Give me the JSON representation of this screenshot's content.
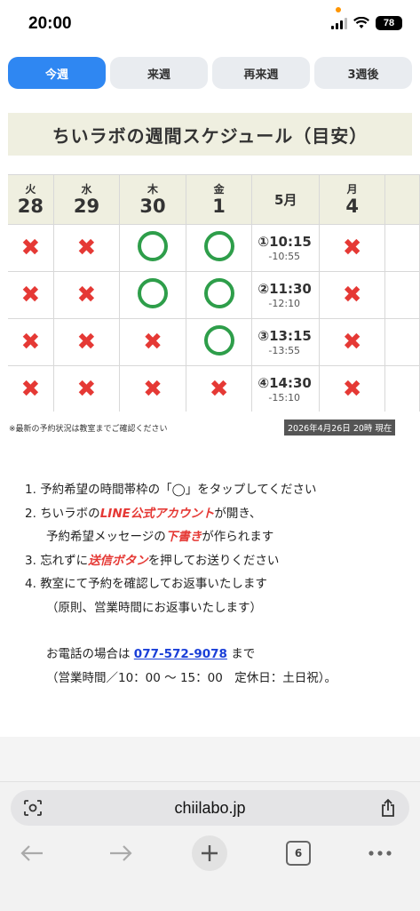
{
  "status": {
    "time": "20:00",
    "battery": "78"
  },
  "tabs": [
    {
      "label": "今週",
      "active": true
    },
    {
      "label": "来週",
      "active": false
    },
    {
      "label": "再来週",
      "active": false
    },
    {
      "label": "3週後",
      "active": false
    }
  ],
  "title": "ちいラボの週間スケジュール（目安）",
  "schedule": {
    "days": [
      {
        "dow": "火",
        "num": "28"
      },
      {
        "dow": "水",
        "num": "29"
      },
      {
        "dow": "木",
        "num": "30"
      },
      {
        "dow": "金",
        "num": "1"
      },
      {
        "month": "5月"
      },
      {
        "dow": "月",
        "num": "4"
      }
    ],
    "slots": [
      {
        "start": "①10:15",
        "end": "-10:55"
      },
      {
        "start": "②11:30",
        "end": "-12:10"
      },
      {
        "start": "③13:15",
        "end": "-13:55"
      },
      {
        "start": "④14:30",
        "end": "-15:10"
      }
    ],
    "availability": [
      [
        "unavailable",
        "unavailable",
        "available",
        "available",
        "unavailable"
      ],
      [
        "unavailable",
        "unavailable",
        "available",
        "available",
        "unavailable"
      ],
      [
        "unavailable",
        "unavailable",
        "unavailable",
        "available",
        "unavailable"
      ],
      [
        "unavailable",
        "unavailable",
        "unavailable",
        "unavailable",
        "unavailable"
      ]
    ],
    "symbols": {
      "unavailable": "✖"
    }
  },
  "note": "※最新の予約状況は教室までご確認ください",
  "timestamp": "2026年4月26日 20時 現在",
  "steps": {
    "s1": {
      "num": "1.",
      "text": "予約希望の時間帯枠の「◯」をタップしてください"
    },
    "s2": {
      "num": "2.",
      "pre": "ちいラボの",
      "em": "LINE公式アカウント",
      "post": "が開き、"
    },
    "s2b": {
      "pre": "予約希望メッセージの",
      "em": "下書き",
      "post": "が作られます"
    },
    "s3": {
      "num": "3.",
      "pre": "忘れずに",
      "em": "送信ボタン",
      "post": "を押してお送りください"
    },
    "s4": {
      "num": "4.",
      "text": "教室にて予約を確認してお返事いたします"
    },
    "s4b": {
      "text": "（原則、営業時間にお返事いたします）"
    }
  },
  "phone": {
    "pre": "お電話の場合は ",
    "number": "077-572-9078",
    "post": " まで"
  },
  "hours": "（営業時間／10：00 ～ 15：00　定休日：土日祝）。",
  "browser": {
    "url": "chiilabo.jp",
    "tab_count": "6"
  }
}
